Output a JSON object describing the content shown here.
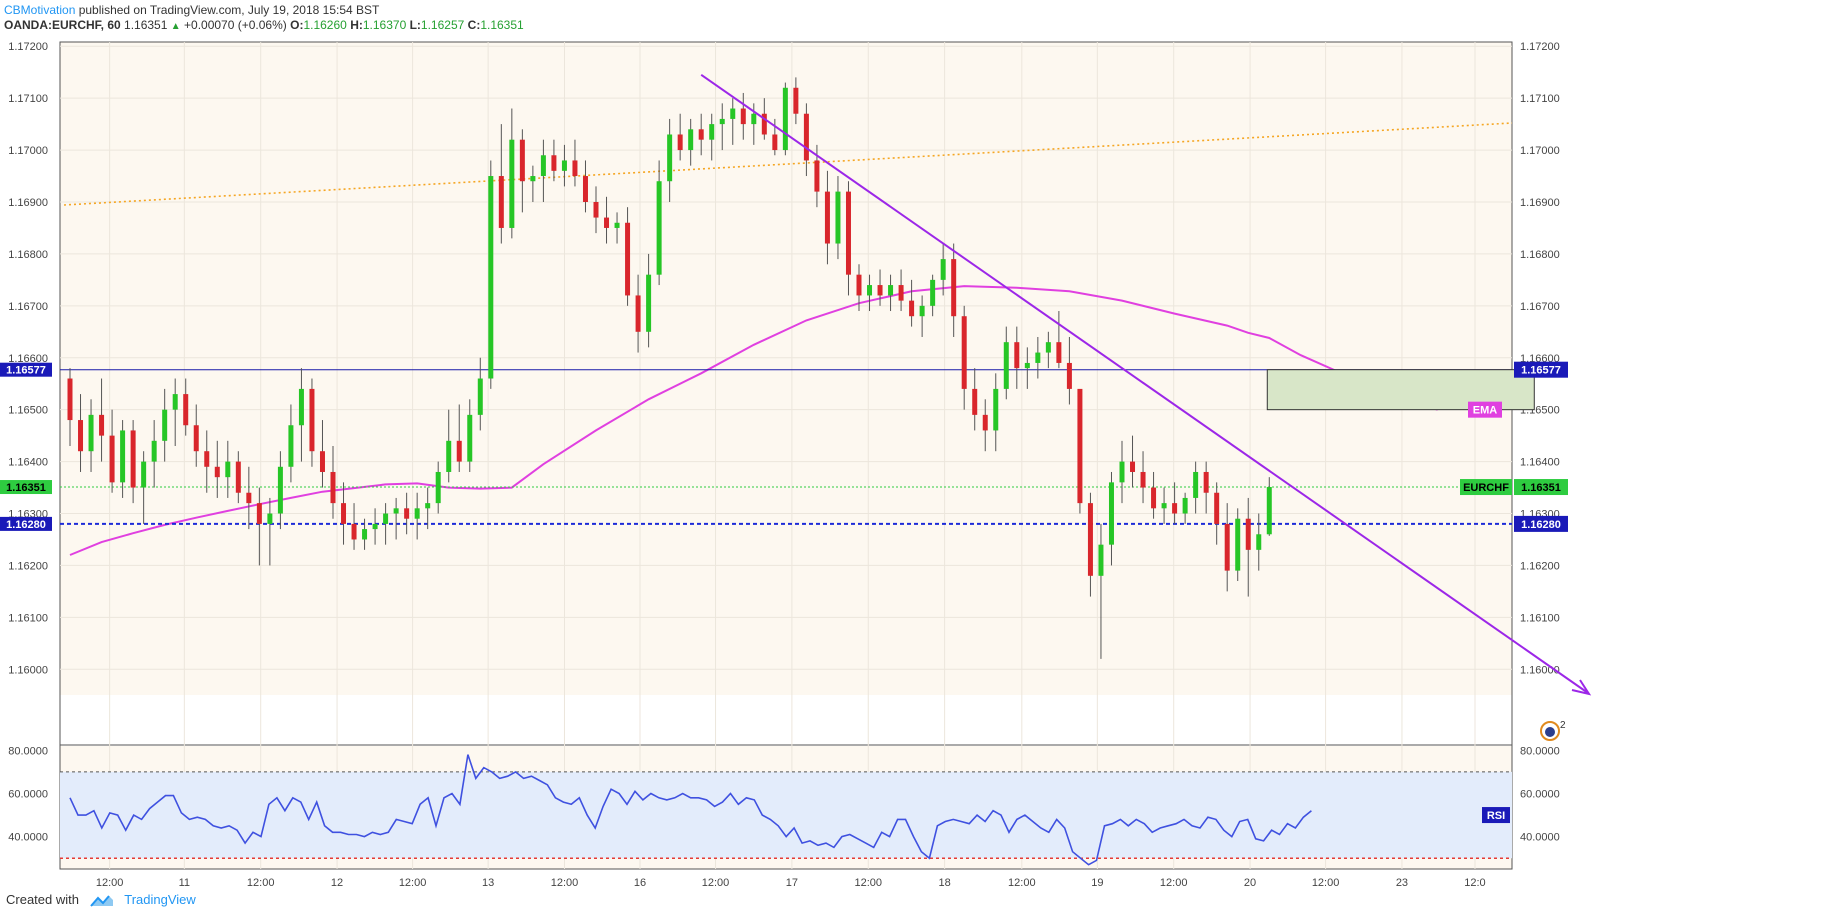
{
  "header": {
    "author": "CBMotivation",
    "published": " published on TradingView.com, July 19, 2018 15:54 BST",
    "symbol": "OANDA:EURCHF, 60",
    "last": "1.16351",
    "arrow": "▲",
    "change": "+0.00070 (+0.06%)",
    "o_label": "O:",
    "o": "1.16260",
    "h_label": "H:",
    "h": "1.16370",
    "l_label": "L:",
    "l": "1.16257",
    "c_label": "C:",
    "c": "1.16351"
  },
  "footer": {
    "created": "Created with",
    "brand": "TradingView"
  },
  "colors": {
    "up": "#26c626",
    "down": "#d9262c",
    "ema": "#e040e0",
    "rsi": "#3f51e0",
    "trend": "#9c27e8",
    "channel": "#f5a623",
    "level": "#1a1aa8",
    "bg": "#fdf8f0"
  },
  "chart_data": {
    "type": "candlestick",
    "symbol": "EURCHF",
    "timeframe": "60",
    "ylim": [
      1.15962,
      1.17212
    ],
    "price_ticks": [
      "1.17200",
      "1.17100",
      "1.17000",
      "1.16900",
      "1.16800",
      "1.16700",
      "1.16600",
      "1.16500",
      "1.16400",
      "1.16300",
      "1.16200",
      "1.16100",
      "1.16000"
    ],
    "x_ticks": [
      "12:00",
      "11",
      "12:00",
      "12",
      "12:00",
      "13",
      "12:00",
      "16",
      "12:00",
      "17",
      "12:00",
      "18",
      "12:00",
      "19",
      "12:00",
      "20",
      "12:00",
      "23",
      "12:0"
    ],
    "ohlc": [
      [
        1.1656,
        1.1658,
        1.1643,
        1.1648
      ],
      [
        1.1648,
        1.1653,
        1.1638,
        1.1642
      ],
      [
        1.1642,
        1.1652,
        1.1638,
        1.1649
      ],
      [
        1.1649,
        1.1656,
        1.164,
        1.1645
      ],
      [
        1.1645,
        1.165,
        1.1634,
        1.1636
      ],
      [
        1.1636,
        1.1648,
        1.1633,
        1.1646
      ],
      [
        1.1646,
        1.1648,
        1.1632,
        1.1635
      ],
      [
        1.1635,
        1.1642,
        1.1628,
        1.164
      ],
      [
        1.164,
        1.1648,
        1.1635,
        1.1644
      ],
      [
        1.1644,
        1.1654,
        1.164,
        1.165
      ],
      [
        1.165,
        1.1656,
        1.1643,
        1.1653
      ],
      [
        1.1653,
        1.1656,
        1.1645,
        1.1647
      ],
      [
        1.1647,
        1.1651,
        1.1639,
        1.1642
      ],
      [
        1.1642,
        1.1646,
        1.1634,
        1.1639
      ],
      [
        1.1639,
        1.1644,
        1.1633,
        1.1637
      ],
      [
        1.1637,
        1.1644,
        1.1633,
        1.164
      ],
      [
        1.164,
        1.1642,
        1.1632,
        1.1634
      ],
      [
        1.1634,
        1.1639,
        1.1627,
        1.1632
      ],
      [
        1.1632,
        1.1635,
        1.162,
        1.1628
      ],
      [
        1.1628,
        1.1633,
        1.162,
        1.163
      ],
      [
        1.163,
        1.1642,
        1.1627,
        1.1639
      ],
      [
        1.1639,
        1.1651,
        1.1636,
        1.1647
      ],
      [
        1.1647,
        1.1658,
        1.164,
        1.1654
      ],
      [
        1.1654,
        1.1656,
        1.1639,
        1.1642
      ],
      [
        1.1642,
        1.1648,
        1.1635,
        1.1638
      ],
      [
        1.1638,
        1.1643,
        1.1629,
        1.1632
      ],
      [
        1.1632,
        1.1636,
        1.1624,
        1.1628
      ],
      [
        1.1628,
        1.1632,
        1.1623,
        1.1625
      ],
      [
        1.1625,
        1.1629,
        1.1623,
        1.1627
      ],
      [
        1.1627,
        1.1631,
        1.1624,
        1.1628
      ],
      [
        1.1628,
        1.1632,
        1.1624,
        1.163
      ],
      [
        1.163,
        1.1633,
        1.1625,
        1.1631
      ],
      [
        1.1631,
        1.1634,
        1.1626,
        1.1629
      ],
      [
        1.1629,
        1.1634,
        1.1625,
        1.1631
      ],
      [
        1.1631,
        1.1635,
        1.1627,
        1.1632
      ],
      [
        1.1632,
        1.164,
        1.163,
        1.1638
      ],
      [
        1.1638,
        1.165,
        1.1636,
        1.1644
      ],
      [
        1.1644,
        1.1651,
        1.1638,
        1.164
      ],
      [
        1.164,
        1.1652,
        1.1638,
        1.1649
      ],
      [
        1.1649,
        1.166,
        1.1646,
        1.1656
      ],
      [
        1.1656,
        1.1698,
        1.1654,
        1.1695
      ],
      [
        1.1695,
        1.1705,
        1.1682,
        1.1685
      ],
      [
        1.1685,
        1.1708,
        1.1683,
        1.1702
      ],
      [
        1.1702,
        1.1704,
        1.1688,
        1.1694
      ],
      [
        1.1694,
        1.1697,
        1.169,
        1.1695
      ],
      [
        1.1695,
        1.1702,
        1.169,
        1.1699
      ],
      [
        1.1699,
        1.1702,
        1.1694,
        1.1696
      ],
      [
        1.1696,
        1.1701,
        1.1693,
        1.1698
      ],
      [
        1.1698,
        1.1702,
        1.1693,
        1.1695
      ],
      [
        1.1695,
        1.1698,
        1.1688,
        1.169
      ],
      [
        1.169,
        1.1693,
        1.1684,
        1.1687
      ],
      [
        1.1687,
        1.1691,
        1.1682,
        1.1685
      ],
      [
        1.1685,
        1.1688,
        1.1682,
        1.1686
      ],
      [
        1.1686,
        1.1689,
        1.167,
        1.1672
      ],
      [
        1.1672,
        1.1676,
        1.1661,
        1.1665
      ],
      [
        1.1665,
        1.168,
        1.1662,
        1.1676
      ],
      [
        1.1676,
        1.1698,
        1.1674,
        1.1694
      ],
      [
        1.1694,
        1.1706,
        1.169,
        1.1703
      ],
      [
        1.1703,
        1.1707,
        1.1698,
        1.17
      ],
      [
        1.17,
        1.1706,
        1.1697,
        1.1704
      ],
      [
        1.1704,
        1.1707,
        1.1699,
        1.1702
      ],
      [
        1.1702,
        1.1707,
        1.1698,
        1.1705
      ],
      [
        1.1705,
        1.1709,
        1.17,
        1.1706
      ],
      [
        1.1706,
        1.171,
        1.1701,
        1.1708
      ],
      [
        1.1708,
        1.1711,
        1.1702,
        1.1705
      ],
      [
        1.1705,
        1.1709,
        1.1701,
        1.1707
      ],
      [
        1.1707,
        1.171,
        1.1702,
        1.1703
      ],
      [
        1.1703,
        1.1706,
        1.1699,
        1.17
      ],
      [
        1.17,
        1.1713,
        1.1699,
        1.1712
      ],
      [
        1.1712,
        1.1714,
        1.1705,
        1.1707
      ],
      [
        1.1707,
        1.1709,
        1.1695,
        1.1698
      ],
      [
        1.1698,
        1.1701,
        1.1689,
        1.1692
      ],
      [
        1.1692,
        1.1696,
        1.1678,
        1.1682
      ],
      [
        1.1682,
        1.1695,
        1.1679,
        1.1692
      ],
      [
        1.1692,
        1.1694,
        1.1672,
        1.1676
      ],
      [
        1.1676,
        1.1678,
        1.1669,
        1.1672
      ],
      [
        1.1672,
        1.1676,
        1.1669,
        1.1674
      ],
      [
        1.1674,
        1.1677,
        1.167,
        1.1672
      ],
      [
        1.1672,
        1.1676,
        1.1669,
        1.1674
      ],
      [
        1.1674,
        1.1677,
        1.1669,
        1.1671
      ],
      [
        1.1671,
        1.1675,
        1.1666,
        1.1668
      ],
      [
        1.1668,
        1.1672,
        1.1664,
        1.167
      ],
      [
        1.167,
        1.1676,
        1.1668,
        1.1675
      ],
      [
        1.1675,
        1.1682,
        1.1672,
        1.1679
      ],
      [
        1.1679,
        1.1682,
        1.1664,
        1.1668
      ],
      [
        1.1668,
        1.167,
        1.165,
        1.1654
      ],
      [
        1.1654,
        1.1658,
        1.1646,
        1.1649
      ],
      [
        1.1649,
        1.1652,
        1.1642,
        1.1646
      ],
      [
        1.1646,
        1.1657,
        1.1642,
        1.1654
      ],
      [
        1.1654,
        1.1666,
        1.1652,
        1.1663
      ],
      [
        1.1663,
        1.1666,
        1.1654,
        1.1658
      ],
      [
        1.1658,
        1.1662,
        1.1654,
        1.1659
      ],
      [
        1.1659,
        1.1664,
        1.1656,
        1.1661
      ],
      [
        1.1661,
        1.1665,
        1.1658,
        1.1663
      ],
      [
        1.1663,
        1.1669,
        1.1658,
        1.1659
      ],
      [
        1.1659,
        1.1664,
        1.1651,
        1.1654
      ],
      [
        1.1654,
        1.1652,
        1.163,
        1.1632
      ],
      [
        1.1632,
        1.1634,
        1.1614,
        1.1618
      ],
      [
        1.1618,
        1.1628,
        1.1602,
        1.1624
      ],
      [
        1.1624,
        1.1638,
        1.162,
        1.1636
      ],
      [
        1.1636,
        1.1644,
        1.1632,
        1.164
      ],
      [
        1.164,
        1.1645,
        1.1635,
        1.1638
      ],
      [
        1.1638,
        1.1642,
        1.1632,
        1.1635
      ],
      [
        1.1635,
        1.1638,
        1.1629,
        1.1631
      ],
      [
        1.1631,
        1.1635,
        1.1628,
        1.1632
      ],
      [
        1.1632,
        1.1636,
        1.1628,
        1.163
      ],
      [
        1.163,
        1.1634,
        1.1628,
        1.1633
      ],
      [
        1.1633,
        1.164,
        1.163,
        1.1638
      ],
      [
        1.1638,
        1.164,
        1.163,
        1.1634
      ],
      [
        1.1634,
        1.1636,
        1.1624,
        1.1628
      ],
      [
        1.1628,
        1.1632,
        1.1615,
        1.1619
      ],
      [
        1.1619,
        1.1631,
        1.1617,
        1.1629
      ],
      [
        1.1629,
        1.1633,
        1.1614,
        1.1623
      ],
      [
        1.1623,
        1.163,
        1.1619,
        1.1626
      ],
      [
        1.1626,
        1.1637,
        1.16257,
        1.16351
      ]
    ],
    "ema_label": "EMA",
    "ema": [
      1.1622,
      1.16245,
      1.16262,
      1.16278,
      1.16292,
      1.16305,
      1.16318,
      1.1633,
      1.16342,
      1.16349,
      1.16356,
      1.16358,
      1.1635,
      1.16348,
      1.1635,
      1.16395,
      1.1646,
      1.1652,
      1.1657,
      1.16625,
      1.16672,
      1.16705,
      1.16728,
      1.16738,
      1.16735,
      1.16728,
      1.1671,
      1.16685,
      1.16662,
      1.16648,
      1.16638,
      1.16605,
      1.1656,
      1.16525,
      1.165
    ],
    "ema_x": [
      0,
      3,
      6,
      9,
      12,
      15,
      18,
      21,
      24,
      27,
      30,
      33,
      36,
      39,
      42,
      45,
      50,
      55,
      60,
      65,
      70,
      75,
      80,
      85,
      90,
      95,
      100,
      105,
      110,
      112,
      114,
      117,
      122,
      126,
      130
    ],
    "rsi_label": "RSI",
    "rsi_ticks": [
      "80.0000",
      "60.0000",
      "40.0000"
    ],
    "rsi_levels": [
      70,
      30
    ],
    "rsi": [
      58,
      50,
      50,
      52,
      44,
      51,
      50,
      43,
      50,
      48,
      53,
      56,
      59,
      59,
      51,
      48,
      49,
      48,
      45,
      44,
      45,
      43,
      37,
      42,
      40,
      55,
      58,
      52,
      58,
      56,
      48,
      56,
      45,
      42,
      42,
      41,
      41,
      40,
      42,
      41,
      42,
      48,
      47,
      46,
      55,
      58,
      45,
      58,
      60,
      55,
      78,
      67,
      72,
      70,
      67,
      68,
      70,
      67,
      68,
      66,
      64,
      58,
      56,
      55,
      58,
      50,
      44,
      54,
      62,
      60,
      55,
      61,
      57,
      60,
      58,
      57,
      58,
      60,
      58,
      58,
      57,
      54,
      56,
      60,
      55,
      58,
      57,
      50,
      48,
      45,
      40,
      44,
      37,
      38,
      36,
      37,
      35,
      40,
      41,
      39,
      37,
      35,
      42,
      40,
      48,
      48,
      40,
      33,
      30,
      45,
      47,
      48,
      47,
      46,
      50,
      47,
      52,
      50,
      42,
      48,
      50,
      47,
      44,
      42,
      48,
      44,
      33,
      30,
      27,
      29,
      45,
      46,
      48,
      45,
      48,
      46,
      42,
      44,
      45,
      46,
      48,
      45,
      44,
      49,
      48,
      43,
      40,
      47,
      48,
      39,
      38,
      43,
      41,
      46,
      44,
      49,
      52
    ]
  },
  "labels": {
    "level_top": "1.16577",
    "level_bottom": "1.16280",
    "current": "1.16351",
    "symbol_tag": "EURCHF",
    "ema_tag": "EMA",
    "rsi_tag": "RSI",
    "event_badge": "2"
  }
}
